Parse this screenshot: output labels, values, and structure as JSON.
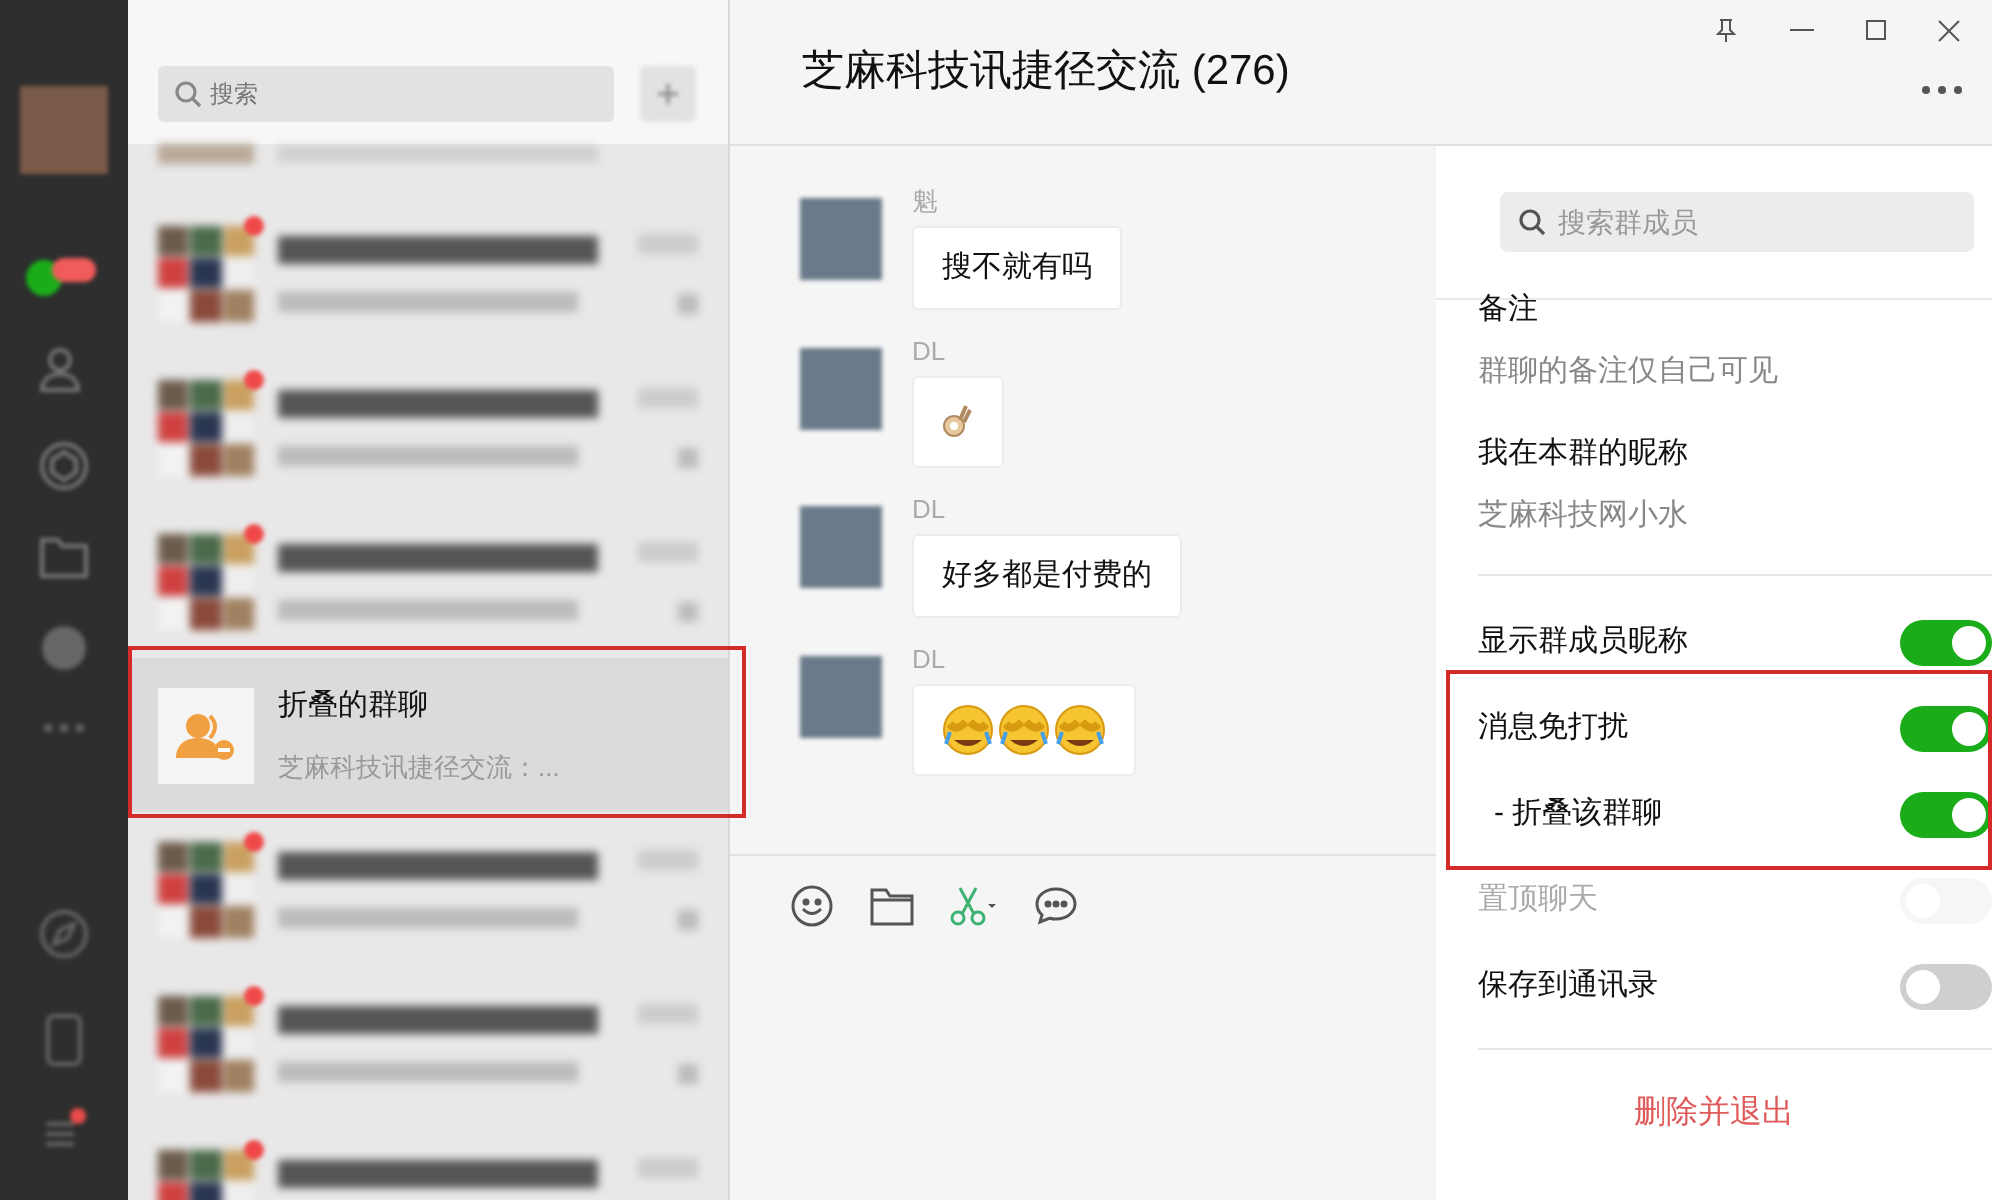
{
  "chat_list": {
    "search": {
      "placeholder": "搜索"
    },
    "items": [
      {
        "kind": "blurred",
        "badge": true,
        "selected": false
      },
      {
        "kind": "blurred",
        "badge": true,
        "selected": false
      },
      {
        "kind": "blurred",
        "badge": true,
        "selected": false
      },
      {
        "kind": "folded",
        "name": "折叠的群聊",
        "preview": "芝麻科技讯捷径交流：...",
        "selected": true,
        "highlighted": true
      },
      {
        "kind": "blurred",
        "badge": true,
        "selected": false
      },
      {
        "kind": "blurred",
        "badge": true,
        "selected": false
      },
      {
        "kind": "blurred",
        "badge": true,
        "selected": false
      }
    ]
  },
  "chat": {
    "title": "芝麻科技讯捷径交流 (276)",
    "messages": [
      {
        "sender": "魁",
        "kind": "text",
        "text": "搜不就有吗"
      },
      {
        "sender": "DL",
        "kind": "emoji",
        "emojis": [
          {
            "kind": "ok"
          }
        ]
      },
      {
        "sender": "DL",
        "kind": "text",
        "text": "好多都是付费的"
      },
      {
        "sender": "DL",
        "kind": "emoji",
        "emojis": [
          {
            "kind": "facepalm"
          },
          {
            "kind": "facepalm"
          },
          {
            "kind": "facepalm"
          }
        ]
      }
    ]
  },
  "settings": {
    "search": {
      "placeholder": "搜索群成员"
    },
    "fields": [
      {
        "label": "备注",
        "value": "群聊的备注仅自己可见"
      },
      {
        "label": "我在本群的昵称",
        "value": "芝麻科技网小水"
      }
    ],
    "toggles": [
      {
        "label": "显示群成员昵称",
        "on": true,
        "disabled": false,
        "sub": false,
        "highlighted": false
      },
      {
        "label": "消息免打扰",
        "on": true,
        "disabled": false,
        "sub": false,
        "highlighted": true
      },
      {
        "label": "- 折叠该群聊",
        "on": true,
        "disabled": false,
        "sub": true,
        "highlighted": true
      },
      {
        "label": "置顶聊天",
        "on": false,
        "disabled": true,
        "sub": false,
        "highlighted": false
      },
      {
        "label": "保存到通讯录",
        "on": false,
        "disabled": false,
        "sub": false,
        "highlighted": false
      }
    ],
    "exit_button": "删除并退出"
  }
}
